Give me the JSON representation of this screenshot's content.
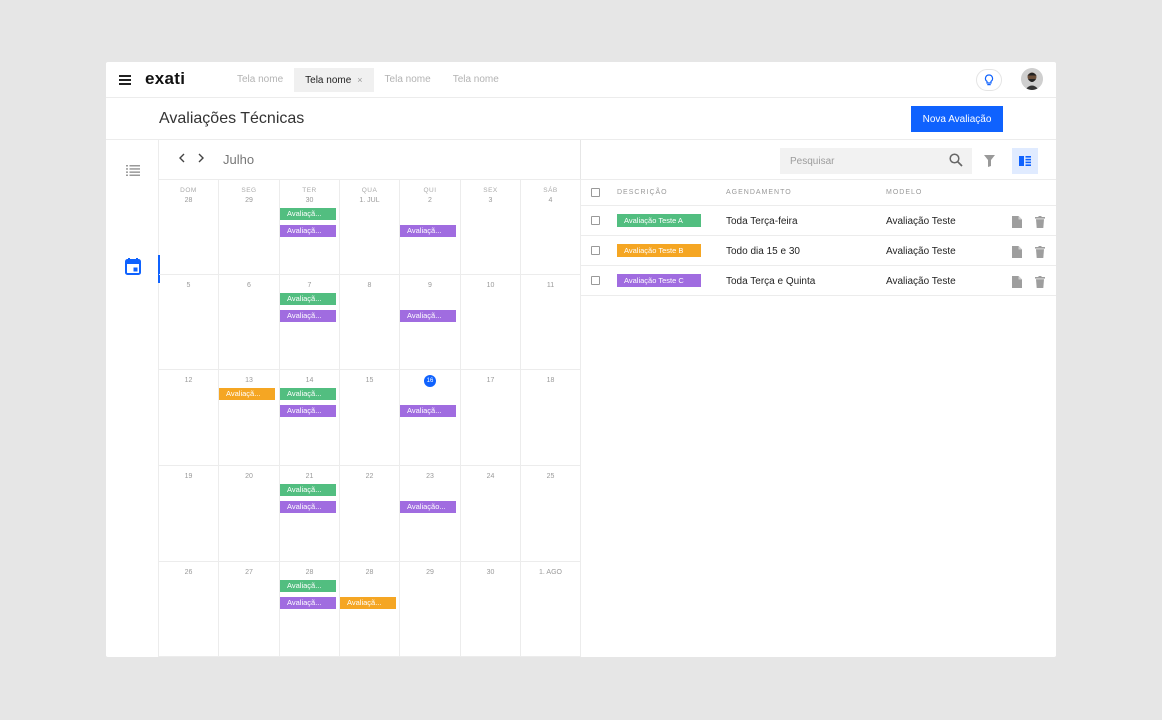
{
  "app": {
    "logo": "exati",
    "page_title": "Avaliações Técnicas"
  },
  "topbar": {
    "tabs": [
      {
        "label": "Tela nome",
        "active": false
      },
      {
        "label": "Tela nome",
        "active": true,
        "close": "×"
      },
      {
        "label": "Tela nome",
        "active": false
      },
      {
        "label": "Tela nome",
        "active": false
      }
    ],
    "icons": [
      "menu-icon",
      "lightbulb-icon",
      "user-avatar"
    ]
  },
  "header": {
    "new_button": "Nova Avaliação"
  },
  "rail": {
    "icons": [
      "list-icon",
      "calendar-icon"
    ],
    "active": "calendar-icon"
  },
  "calendar": {
    "month": "Julho",
    "weekdays": [
      "DOM",
      "SEG",
      "TER",
      "QUA",
      "QUI",
      "SEX",
      "SÁB"
    ],
    "weeks": [
      [
        "28",
        "29",
        "30",
        "1. JUL",
        "2",
        "3",
        "4"
      ],
      [
        "5",
        "6",
        "7",
        "8",
        "9",
        "10",
        "11"
      ],
      [
        "12",
        "13",
        "14",
        "15",
        "16",
        "17",
        "18"
      ],
      [
        "19",
        "20",
        "21",
        "22",
        "23",
        "24",
        "25"
      ],
      [
        "26",
        "27",
        "28",
        "28",
        "29",
        "30",
        "1. AGO"
      ]
    ],
    "today": "16",
    "events": [
      {
        "week": 0,
        "day": 2,
        "slot": 0,
        "label": "Avaliaçã...",
        "color": "green"
      },
      {
        "week": 0,
        "day": 2,
        "slot": 1,
        "label": "Avaliaçã...",
        "color": "purple"
      },
      {
        "week": 0,
        "day": 4,
        "slot": 1,
        "label": "Avaliaçã...",
        "color": "purple"
      },
      {
        "week": 1,
        "day": 2,
        "slot": 0,
        "label": "Avaliaçã...",
        "color": "green"
      },
      {
        "week": 1,
        "day": 2,
        "slot": 1,
        "label": "Avaliaçã...",
        "color": "purple"
      },
      {
        "week": 1,
        "day": 4,
        "slot": 1,
        "label": "Avaliaçã...",
        "color": "purple"
      },
      {
        "week": 2,
        "day": 1,
        "slot": 0,
        "label": "Avaliaçã...",
        "color": "orange"
      },
      {
        "week": 2,
        "day": 2,
        "slot": 0,
        "label": "Avaliaçã...",
        "color": "green"
      },
      {
        "week": 2,
        "day": 2,
        "slot": 1,
        "label": "Avaliaçã...",
        "color": "purple"
      },
      {
        "week": 2,
        "day": 4,
        "slot": 1,
        "label": "Avaliaçã...",
        "color": "purple"
      },
      {
        "week": 3,
        "day": 2,
        "slot": 0,
        "label": "Avaliaçã...",
        "color": "green"
      },
      {
        "week": 3,
        "day": 2,
        "slot": 1,
        "label": "Avaliaçã...",
        "color": "purple"
      },
      {
        "week": 3,
        "day": 4,
        "slot": 1,
        "label": "Avaliação...",
        "color": "purple"
      },
      {
        "week": 4,
        "day": 2,
        "slot": 0,
        "label": "Avaliaçã...",
        "color": "green"
      },
      {
        "week": 4,
        "day": 2,
        "slot": 1,
        "label": "Avaliaçã...",
        "color": "purple"
      },
      {
        "week": 4,
        "day": 3,
        "slot": 1,
        "label": "Avaliaçã...",
        "color": "orange"
      }
    ]
  },
  "list": {
    "search_placeholder": "Pesquisar",
    "columns": [
      "DESCRIÇÃO",
      "AGENDAMENTO",
      "MODELO"
    ],
    "rows": [
      {
        "label": "Avaliação Teste A",
        "color": "green",
        "schedule": "Toda Terça-feira",
        "model": "Avaliação Teste"
      },
      {
        "label": "Avaliação Teste B",
        "color": "orange",
        "schedule": "Todo dia 15 e 30",
        "model": "Avaliação Teste"
      },
      {
        "label": "Avaliação Teste C",
        "color": "purple",
        "schedule": "Toda Terça e Quinta",
        "model": "Avaliação Teste"
      }
    ]
  },
  "colors": {
    "accent": "#0f62fe",
    "green": "#52be80",
    "purple": "#a06ce0",
    "orange": "#f5a623"
  }
}
